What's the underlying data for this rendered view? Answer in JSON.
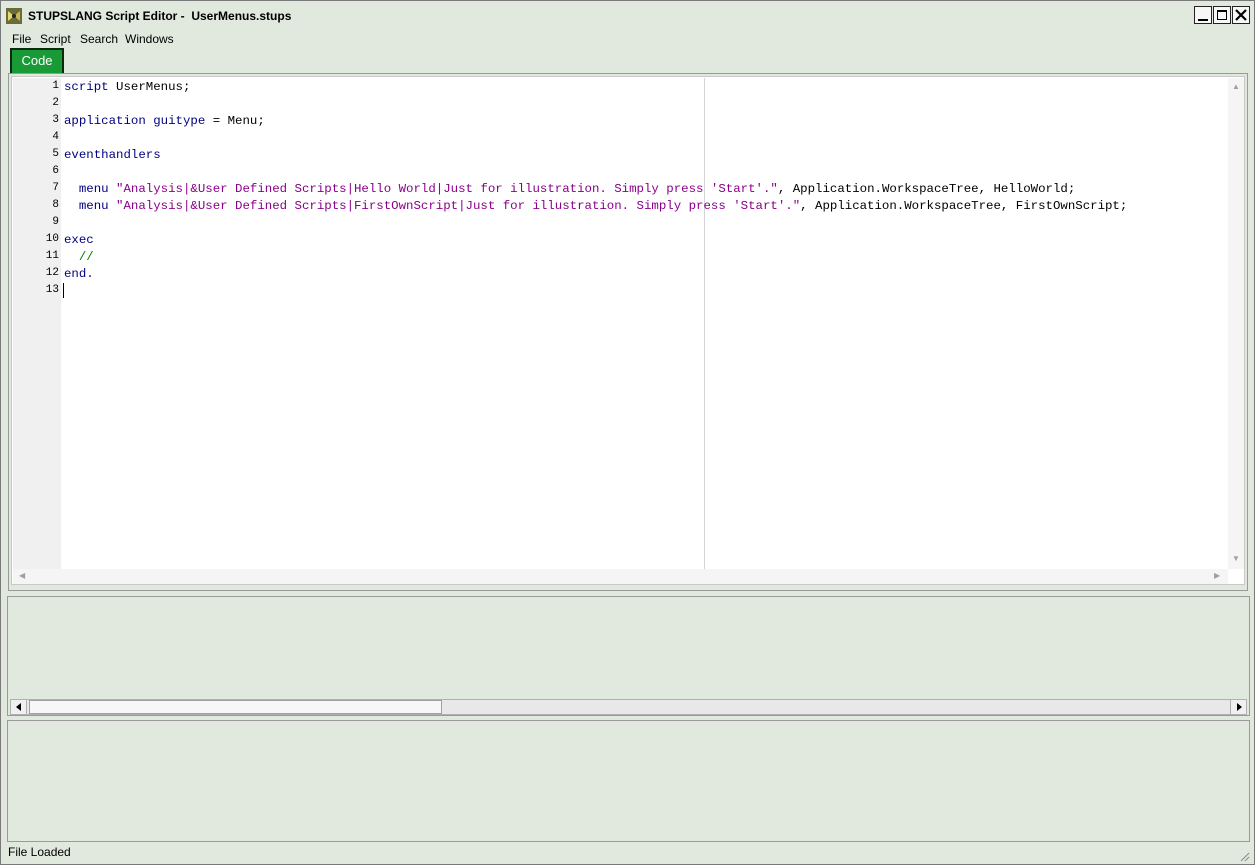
{
  "window": {
    "title": "STUPSLANG Script Editor -  UserMenus.stups",
    "icon": "app-icon"
  },
  "menu": [
    {
      "label": "File"
    },
    {
      "label": "Script"
    },
    {
      "label": "Search"
    },
    {
      "label": "Windows"
    }
  ],
  "tabs": [
    {
      "label": "Code",
      "active": true,
      "color": "#189a36"
    }
  ],
  "editor": {
    "line_numbers": [
      "1",
      "2",
      "3",
      "4",
      "5",
      "6",
      "7",
      "8",
      "9",
      "10",
      "11",
      "12",
      "13"
    ],
    "lines": {
      "l1": {
        "kw": "script",
        "rest": " UserMenus;"
      },
      "l3": {
        "kw1": "application",
        "sp": " ",
        "kw2": "guitype",
        "rest": " = Menu;"
      },
      "l5": {
        "kw": "eventhandlers"
      },
      "l7": {
        "indent": "  ",
        "kw": "menu",
        "str": " \"Analysis|&User Defined Scripts|Hello World|Just for illustration. Simply press 'Start'.\"",
        "rest": ", Application.WorkspaceTree, HelloWorld;"
      },
      "l8": {
        "indent": "  ",
        "kw": "menu",
        "str": " \"Analysis|&User Defined Scripts|FirstOwnScript|Just for illustration. Simply press 'Start'.\"",
        "rest": ", Application.WorkspaceTree, FirstOwnScript;"
      },
      "l10": {
        "kw": "exec"
      },
      "l11": {
        "comment": "  //"
      },
      "l12": {
        "kw": "end."
      }
    },
    "syntax_colors": {
      "keyword": "#000080",
      "string": "#8b008b",
      "comment": "#008000"
    }
  },
  "status": {
    "text": "File Loaded"
  }
}
